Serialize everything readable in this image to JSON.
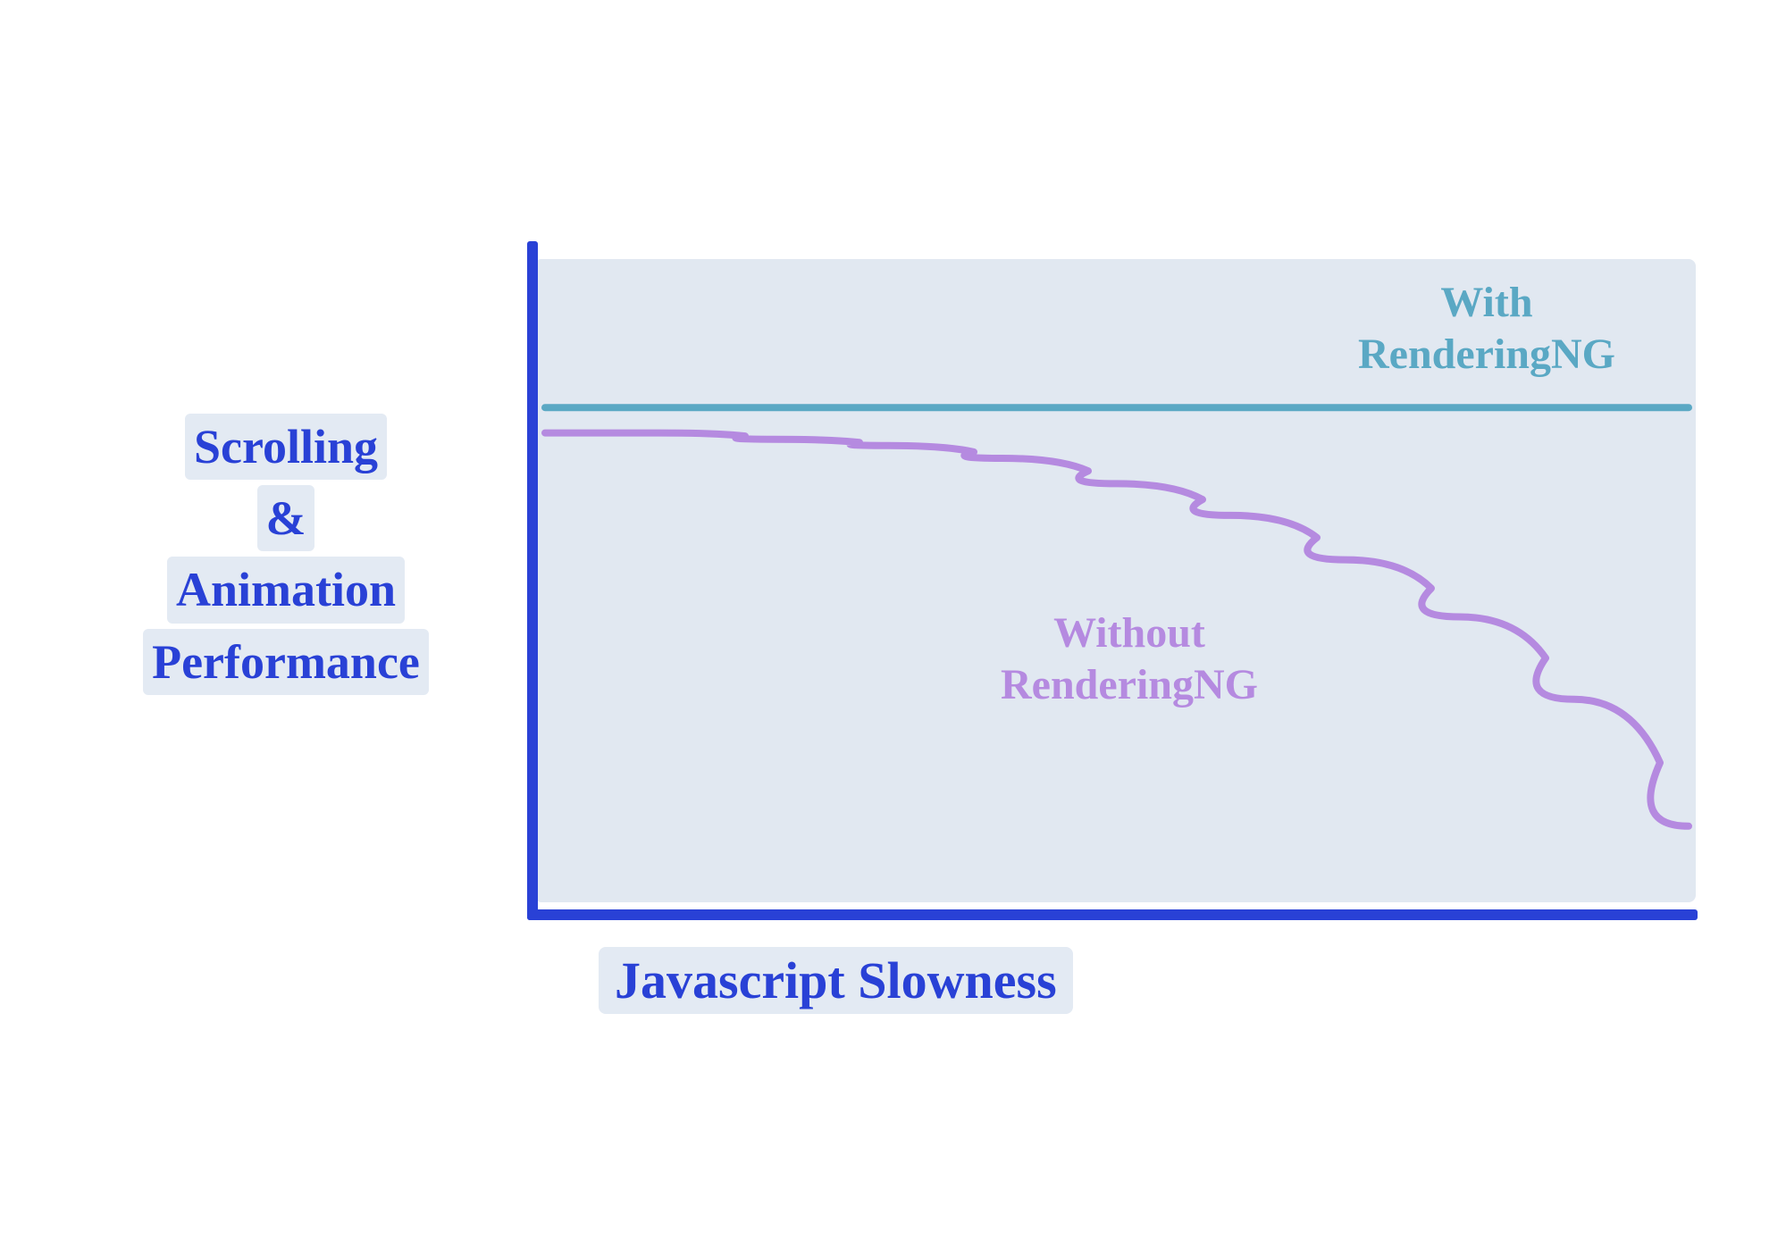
{
  "chart_data": {
    "type": "line",
    "title": "",
    "xlabel": "Javascript Slowness",
    "ylabel_lines": [
      "Scrolling",
      "&",
      "Animation",
      "Performance"
    ],
    "x": [
      0,
      0.1,
      0.2,
      0.3,
      0.4,
      0.5,
      0.6,
      0.7,
      0.8,
      0.9,
      1.0
    ],
    "series": [
      {
        "name": "With RenderingNG",
        "color": "#5aa8c4",
        "values": [
          0.78,
          0.78,
          0.78,
          0.78,
          0.78,
          0.78,
          0.78,
          0.78,
          0.78,
          0.78,
          0.78
        ]
      },
      {
        "name": "Without RenderingNG",
        "color": "#b58ae0",
        "values": [
          0.74,
          0.74,
          0.73,
          0.72,
          0.7,
          0.66,
          0.61,
          0.54,
          0.45,
          0.32,
          0.12
        ]
      }
    ],
    "xlim": [
      0,
      1
    ],
    "ylim": [
      0,
      1
    ],
    "grid": false,
    "legend_position": "inline"
  },
  "labels": {
    "series_with_line1": "With",
    "series_with_line2": "RenderingNG",
    "series_without_line1": "Without",
    "series_without_line2": "RenderingNG",
    "xlabel": "Javascript Slowness",
    "ylabel_line1": "Scrolling",
    "ylabel_line2": "&",
    "ylabel_line3": "Animation",
    "ylabel_line4": "Performance"
  },
  "colors": {
    "axis": "#2941d6",
    "plot_bg": "#e3eaf3",
    "series_with": "#5aa8c4",
    "series_without": "#b58ae0"
  }
}
